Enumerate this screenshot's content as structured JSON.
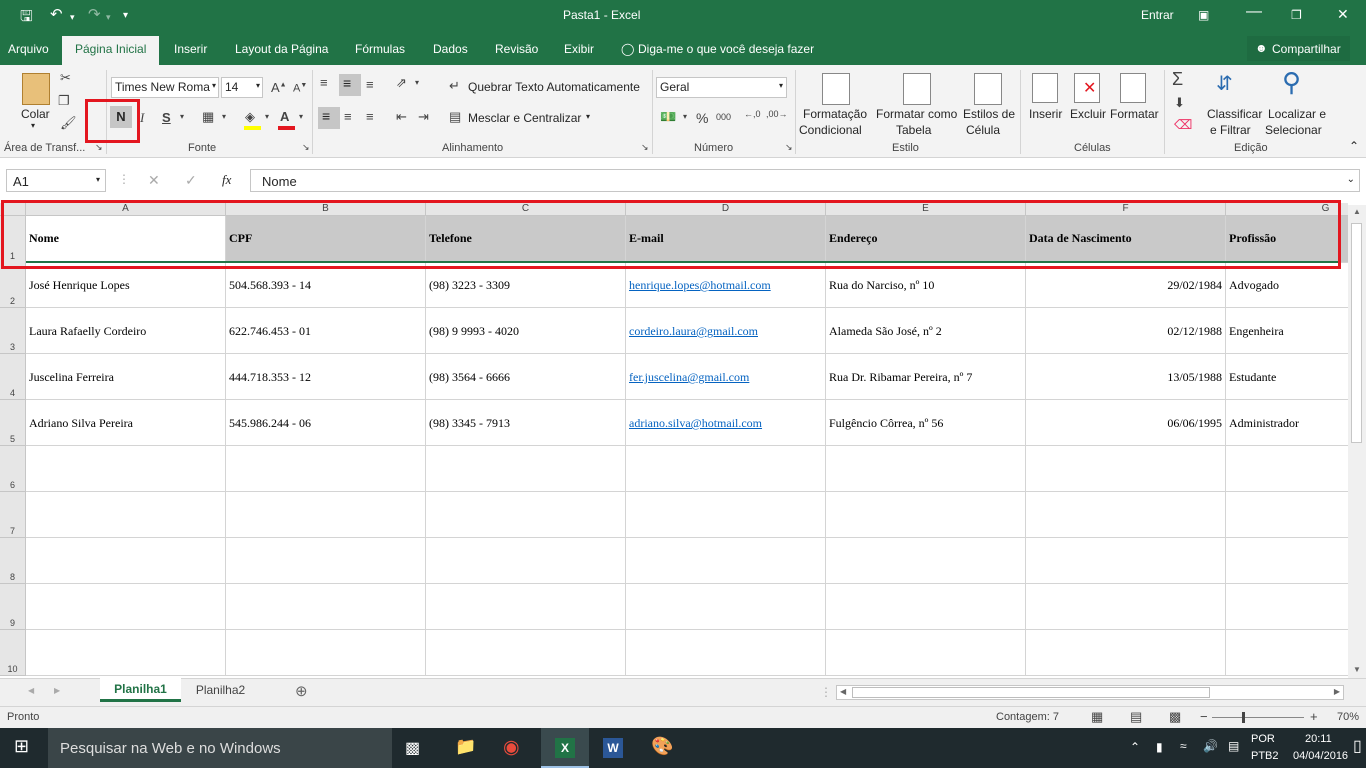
{
  "window": {
    "title": "Pasta1 - Excel",
    "signin": "Entrar"
  },
  "tabs": [
    {
      "label": "Arquivo"
    },
    {
      "label": "Página Inicial"
    },
    {
      "label": "Inserir"
    },
    {
      "label": "Layout da Página"
    },
    {
      "label": "Fórmulas"
    },
    {
      "label": "Dados"
    },
    {
      "label": "Revisão"
    },
    {
      "label": "Exibir"
    }
  ],
  "tellme": "Diga-me o que você deseja fazer",
  "share": "Compartilhar",
  "ribbon": {
    "clipboard": {
      "paste": "Colar",
      "group": "Área de Transf..."
    },
    "font": {
      "name": "Times New Roma",
      "size": "14",
      "bold": "N",
      "italic": "I",
      "underline": "S",
      "group": "Fonte"
    },
    "alignment": {
      "wrap": "Quebrar Texto Automaticamente",
      "merge": "Mesclar e Centralizar",
      "group": "Alinhamento"
    },
    "number": {
      "format": "Geral",
      "percent": "%",
      "thousands": "000",
      "group": "Número"
    },
    "styles": {
      "cond1": "Formatação",
      "cond2": "Condicional",
      "table1": "Formatar como",
      "table2": "Tabela",
      "cell1": "Estilos de",
      "cell2": "Célula",
      "group": "Estilo"
    },
    "cells": {
      "insert": "Inserir",
      "delete": "Excluir",
      "format": "Formatar",
      "group": "Células"
    },
    "editing": {
      "sort1": "Classificar",
      "sort2": "e Filtrar",
      "find1": "Localizar e",
      "find2": "Selecionar",
      "group": "Edição"
    }
  },
  "formula": {
    "namebox": "A1",
    "content": "Nome",
    "fx": "fx"
  },
  "columns": [
    "A",
    "B",
    "C",
    "D",
    "E",
    "F",
    "G"
  ],
  "rows": [
    "1",
    "2",
    "3",
    "4",
    "5",
    "6",
    "7",
    "8",
    "9",
    "10"
  ],
  "sheet": {
    "headers": [
      "Nome",
      "CPF",
      "Telefone",
      "E-mail",
      "Endereço",
      "Data de Nascimento",
      "Profissão"
    ],
    "data": [
      [
        "José Henrique Lopes",
        "504.568.393 - 14",
        "(98) 3223 - 3309",
        "henrique.lopes@hotmail.com",
        "Rua do Narciso, nº 10",
        "29/02/1984",
        "Advogado"
      ],
      [
        "Laura Rafaelly Cordeiro",
        "622.746.453 - 01",
        "(98)  9 9993 - 4020",
        "cordeiro.laura@gmail.com",
        "Alameda São José, nº 2",
        "02/12/1988",
        "Engenheira"
      ],
      [
        "Juscelina Ferreira",
        "444.718.353 - 12",
        "(98) 3564 - 6666",
        "fer.juscelina@gmail.com",
        "Rua Dr. Ribamar Pereira, nº 7",
        "13/05/1988",
        "Estudante"
      ],
      [
        "Adriano Silva Pereira",
        "545.986.244 - 06",
        "(98) 3345 - 7913",
        "adriano.silva@hotmail.com",
        "Fulgêncio Côrrea, nº 56",
        "06/06/1995",
        "Administrador"
      ]
    ]
  },
  "sheettabs": [
    "Planilha1",
    "Planilha2"
  ],
  "status": {
    "ready": "Pronto",
    "count": "Contagem: 7",
    "zoom": "70%"
  },
  "taskbar": {
    "search": "Pesquisar na Web e no Windows",
    "lang1": "POR",
    "lang2": "PTB2",
    "time": "20:11",
    "date": "04/04/2016"
  },
  "colors": {
    "excel_green": "#217346",
    "highlight_red": "#e3161f",
    "header_fill": "#c9c9c9",
    "link": "#0563c1"
  }
}
